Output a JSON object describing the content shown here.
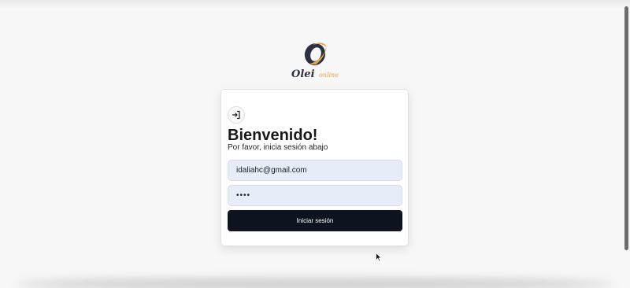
{
  "brand": {
    "name": "Olei",
    "suffix": "online",
    "accent_color": "#e9a24b",
    "dark_color": "#2b3140",
    "logo_icon": "olei-ring-logo"
  },
  "login": {
    "icon": "login-arrow-icon",
    "title": "Bienvenido!",
    "subtitle": "Por favor, inicia sesión abajo",
    "email_value": "idaliahc@gmail.com",
    "password_value": "••••",
    "submit_label": "Iniciar sesión",
    "field_bg_color": "#e6ecf8",
    "button_color": "#0e141f"
  }
}
